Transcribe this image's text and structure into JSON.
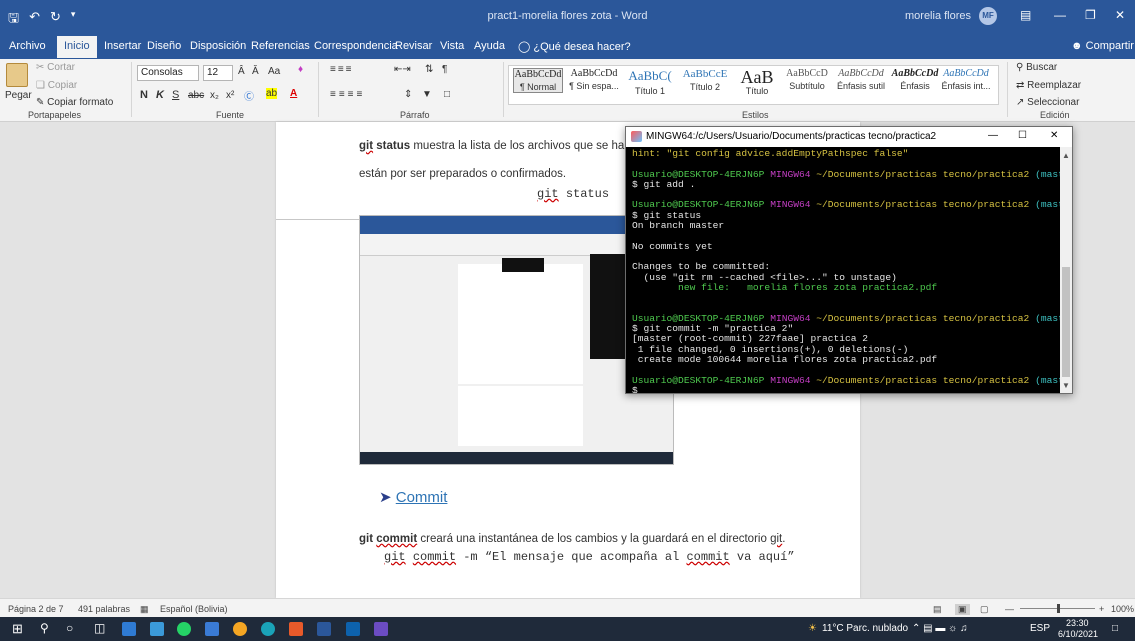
{
  "window": {
    "title": "pract1-morelia flores zota  -  Word",
    "user": "morelia flores",
    "initials": "MF"
  },
  "tabs": [
    "Archivo",
    "Inicio",
    "Insertar",
    "Diseño",
    "Disposición",
    "Referencias",
    "Correspondencia",
    "Revisar",
    "Vista",
    "Ayuda"
  ],
  "tell_me": "¿Qué desea hacer?",
  "share": "Compartir",
  "ribbon": {
    "clipboard": {
      "paste": "Pegar",
      "cut": "Cortar",
      "copy": "Copiar",
      "format_painter": "Copiar formato",
      "label": "Portapapeles"
    },
    "font": {
      "name": "Consolas",
      "size": "12",
      "label": "Fuente",
      "case": "Aa"
    },
    "paragraph": {
      "label": "Párrafo"
    },
    "styles": {
      "label": "Estilos",
      "items": [
        {
          "sample": "AaBbCcDd",
          "name": "¶ Normal"
        },
        {
          "sample": "AaBbCcDd",
          "name": "¶ Sin espa..."
        },
        {
          "sample": "AaBbC(",
          "name": "Título 1"
        },
        {
          "sample": "AaBbCcE",
          "name": "Título 2"
        },
        {
          "sample": "AaB",
          "name": "Título"
        },
        {
          "sample": "AaBbCcD",
          "name": "Subtítulo"
        },
        {
          "sample": "AaBbCcDd",
          "name": "Énfasis sutil"
        },
        {
          "sample": "AaBbCcDd",
          "name": "Énfasis"
        },
        {
          "sample": "AaBbCcDd",
          "name": "Énfasis int..."
        }
      ]
    },
    "editing": {
      "search": "Buscar",
      "replace": "Reemplazar",
      "select": "Seleccionar",
      "label": "Edición"
    }
  },
  "doc": {
    "line1_cmd": "git",
    "line1_bold": "status",
    "line1_rest": "muestra la lista de los archivos que se han camb",
    "line2": "están por ser preparados o confirmados.",
    "code1_a": "git",
    "code1_b": "status",
    "heading": "Commit",
    "para_cmd": "git",
    "para_bold": "commit",
    "para_rest": "creará una instantánea de los cambios y la guardará en el directorio",
    "para_end": "git",
    "code2_a": "git",
    "code2_b": "commit",
    "code2_c": "-m “El mensaje que acompaña al",
    "code2_d": "commit",
    "code2_e": "va aquí”"
  },
  "terminal": {
    "title": "MINGW64:/c/Users/Usuario/Documents/practicas tecno/practica2",
    "hint": "hint: \"git config advice.addEmptyPathspec false\"",
    "prompt_user": "Usuario@DESKTOP-4ERJN6P",
    "prompt_env": "MINGW64",
    "prompt_path": "~/Documents/practicas tecno/practica2",
    "prompt_branch": "(master)",
    "cmd1": "$ git add .",
    "cmd2": "$ git status",
    "out_branch": "On branch master",
    "out_nocommits": "No commits yet",
    "out_changes": "Changes to be committed:",
    "out_unstage": "  (use \"git rm --cached <file>...\" to unstage)",
    "out_newfile": "        new file:   morelia flores zota practica2.pdf",
    "cmd3": "$ git commit -m \"practica 2\"",
    "out_commit1": "[master (root-commit) 227faae] practica 2",
    "out_commit2": " 1 file changed, 0 insertions(+), 0 deletions(-)",
    "out_commit3": " create mode 100644 morelia flores zota practica2.pdf",
    "prompt_end": "$"
  },
  "status": {
    "page": "Página 2 de 7",
    "words": "491 palabras",
    "lang": "Español (Bolivia)",
    "zoom": "100%"
  },
  "taskbar": {
    "weather": "11°C Parc. nublado",
    "lang": "ESP",
    "time": "23:30",
    "date": "6/10/2021"
  }
}
